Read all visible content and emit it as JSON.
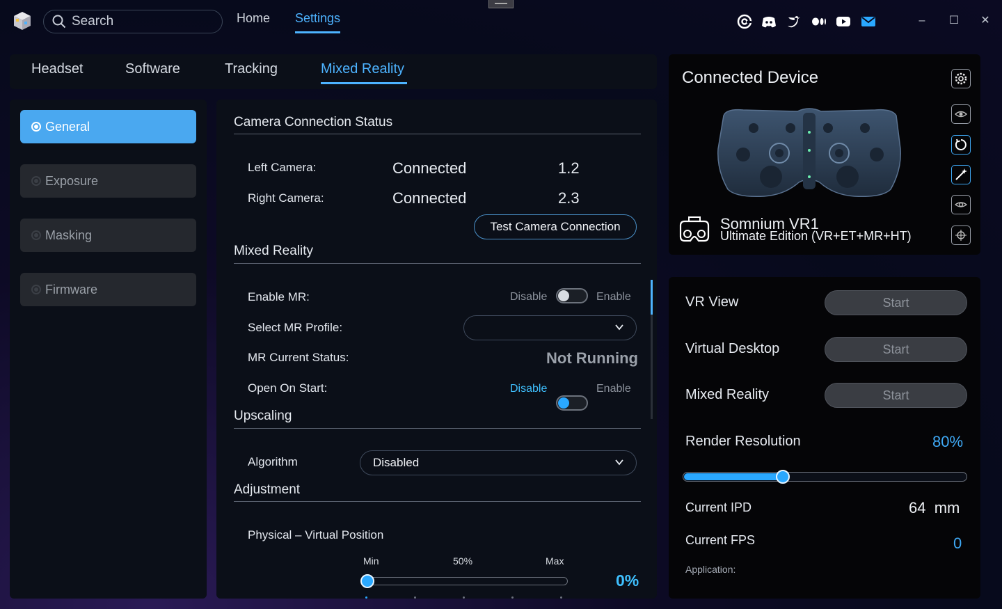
{
  "search": {
    "placeholder": "Search"
  },
  "topnav": {
    "home": "Home",
    "settings": "Settings"
  },
  "social_icons": [
    "at-icon",
    "discord-icon",
    "twitter-icon",
    "medium-icon",
    "youtube-icon",
    "mail-icon"
  ],
  "window": {
    "minimize": "–",
    "maximize": "☐",
    "close": "✕"
  },
  "tabs": [
    "Headset",
    "Software",
    "Tracking",
    "Mixed Reality"
  ],
  "active_tab": "Mixed Reality",
  "sidebar": {
    "items": [
      {
        "label": "General",
        "active": true
      },
      {
        "label": "Exposure",
        "active": false
      },
      {
        "label": "Masking",
        "active": false
      },
      {
        "label": "Firmware",
        "active": false
      }
    ]
  },
  "camera": {
    "title": "Camera Connection Status",
    "left_label": "Left Camera:",
    "left_status": "Connected",
    "left_value": "1.2",
    "right_label": "Right Camera:",
    "right_status": "Connected",
    "right_value": "2.3",
    "test_button": "Test Camera Connection"
  },
  "mixed_reality": {
    "title": "Mixed Reality",
    "enable_label": "Enable MR:",
    "enable_off": "Disable",
    "enable_on": "Enable",
    "enable_state": false,
    "profile_label": "Select MR Profile:",
    "profile_value": "",
    "status_label": "MR Current Status:",
    "status_value": "Not Running",
    "open_label": "Open On Start:",
    "open_off": "Disable",
    "open_on": "Enable",
    "open_state": false
  },
  "upscaling": {
    "title": "Upscaling",
    "algorithm_label": "Algorithm",
    "algorithm_value": "Disabled"
  },
  "adjustment": {
    "title": "Adjustment",
    "position_label": "Physical – Virtual Position",
    "min_label": "Min",
    "mid_label": "50%",
    "max_label": "Max",
    "value_text": "0%",
    "value_fraction": 0
  },
  "device": {
    "title": "Connected Device",
    "name": "Somnium VR1",
    "edition": "Ultimate Edition (VR+ET+MR+HT)",
    "side_icons": [
      "settings-gear-icon",
      "eye-scan-icon",
      "refresh-icon",
      "magic-wand-icon",
      "eye-icon",
      "target-icon"
    ]
  },
  "stats": {
    "vr_view_label": "VR View",
    "virtual_desktop_label": "Virtual Desktop",
    "mixed_reality_label": "Mixed Reality",
    "start_label": "Start",
    "render_label": "Render Resolution",
    "render_value": "80%",
    "render_fraction": 0.35,
    "ipd_label": "Current IPD",
    "ipd_value": "64  mm",
    "fps_label": "Current FPS",
    "fps_value": "0",
    "application_label": "Application:"
  },
  "colors": {
    "accent": "#4db3ff",
    "panel": "#0b0f18",
    "active_sidebar": "#4aa8f0"
  }
}
